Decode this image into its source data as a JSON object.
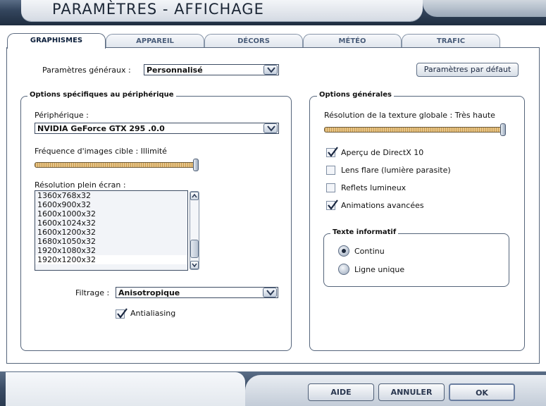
{
  "window": {
    "title": "PARAMÈTRES - AFFICHAGE"
  },
  "tabs": [
    {
      "label": "GRAPHISMES",
      "active": true
    },
    {
      "label": "APPAREIL"
    },
    {
      "label": "DÉCORS"
    },
    {
      "label": "MÉTÉO"
    },
    {
      "label": "TRAFIC"
    }
  ],
  "general": {
    "label": "Paramètres généraux :",
    "value": "Personnalisé",
    "default_button": "Paramètres par défaut"
  },
  "device_group": {
    "title": "Options spécifiques au périphérique",
    "device_label": "Périphérique :",
    "device_value": "NVIDIA GeForce GTX 295 .0.0",
    "framerate_label": "Fréquence d'images cible : Illimité",
    "framerate_level": 1.0,
    "resolution_label": "Résolution plein écran :",
    "resolutions": [
      "1360x768x32",
      "1600x900x32",
      "1600x1000x32",
      "1600x1024x32",
      "1600x1200x32",
      "1680x1050x32",
      "1920x1080x32",
      "1920x1200x32"
    ],
    "selected_resolution": "1920x1200x32",
    "filter_label": "Filtrage :",
    "filter_value": "Anisotropique",
    "antialiasing_label": "Antialiasing",
    "antialiasing_checked": true
  },
  "general_group": {
    "title": "Options générales",
    "texture_label": "Résolution de la texture globale : Très haute",
    "texture_level": 1.0,
    "checkboxes": [
      {
        "label": "Aperçu de DirectX 10",
        "checked": true
      },
      {
        "label": "Lens flare (lumière parasite)",
        "checked": false
      },
      {
        "label": "Reflets lumineux",
        "checked": false
      },
      {
        "label": "Animations avancées",
        "checked": true
      }
    ],
    "info_group": {
      "title": "Texte informatif",
      "options": [
        {
          "label": "Continu",
          "selected": true
        },
        {
          "label": "Ligne unique",
          "selected": false
        }
      ]
    }
  },
  "footer": {
    "help": "AIDE",
    "cancel": "ANNULER",
    "ok": "OK"
  },
  "colors": {
    "frame_dark": "#2f4058",
    "panel_border": "#55657b",
    "slider_track": "#d9b46e"
  },
  "icons": {
    "dropdown": "chevron-down-icon",
    "check": "checkmark-icon",
    "scroll_up": "arrow-up-icon",
    "scroll_down": "arrow-down-icon"
  }
}
